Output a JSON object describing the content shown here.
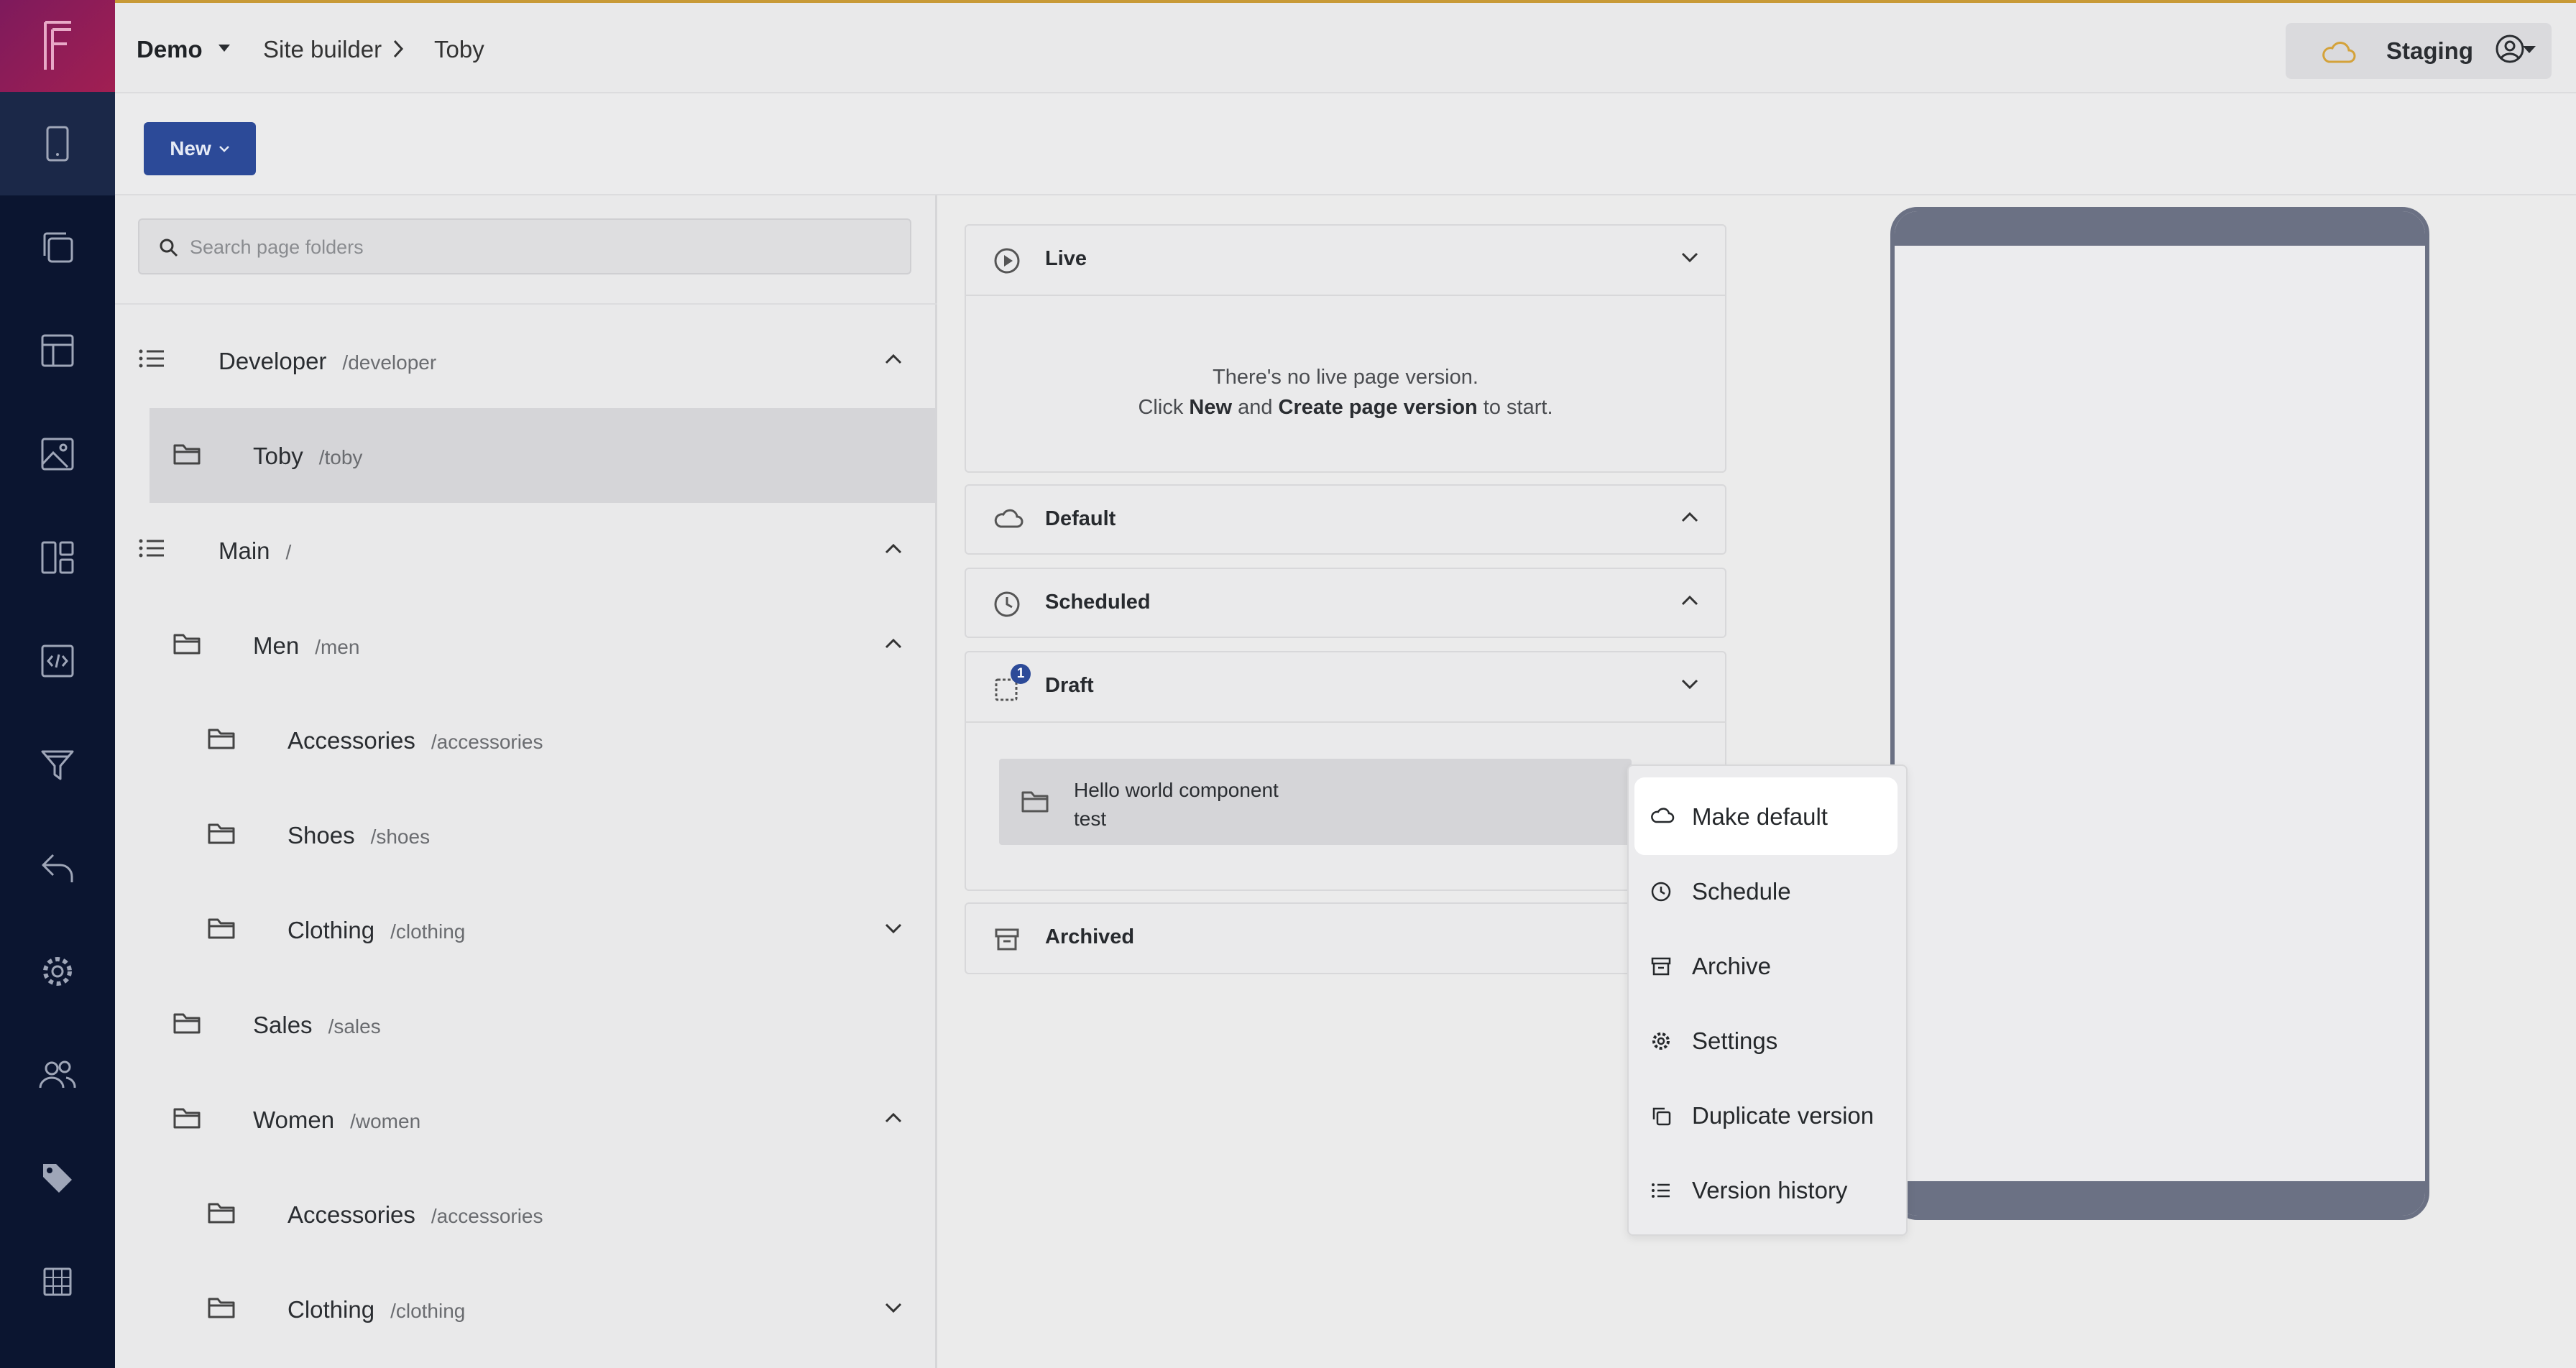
{
  "header": {
    "project": "Demo",
    "breadcrumb": [
      "Site builder",
      "Toby"
    ],
    "environment": "Staging"
  },
  "toolbar": {
    "new_label": "New"
  },
  "sidebar": {
    "items": [
      "logo-icon",
      "device-icon",
      "pages-icon",
      "layout-icon",
      "media-icon",
      "components-icon",
      "code-icon",
      "filter-icon",
      "undo-icon",
      "gear-icon",
      "users-icon",
      "tag-icon",
      "grid-icon"
    ]
  },
  "folders": {
    "search_placeholder": "Search page folders",
    "rows": [
      {
        "name": "Developer",
        "path": "/developer",
        "type": "list",
        "indent": 0,
        "chevron": "up"
      },
      {
        "name": "Toby",
        "path": "/toby",
        "type": "folder",
        "indent": 1,
        "chevron": "",
        "selected": true
      },
      {
        "name": "Main",
        "path": "/",
        "type": "list",
        "indent": 0,
        "chevron": "up"
      },
      {
        "name": "Men",
        "path": "/men",
        "type": "folder",
        "indent": 1,
        "chevron": "up"
      },
      {
        "name": "Accessories",
        "path": "/accessories",
        "type": "folder",
        "indent": 2,
        "chevron": ""
      },
      {
        "name": "Shoes",
        "path": "/shoes",
        "type": "folder",
        "indent": 2,
        "chevron": ""
      },
      {
        "name": "Clothing",
        "path": "/clothing",
        "type": "folder",
        "indent": 2,
        "chevron": "down"
      },
      {
        "name": "Sales",
        "path": "/sales",
        "type": "folder",
        "indent": 1,
        "chevron": ""
      },
      {
        "name": "Women",
        "path": "/women",
        "type": "folder",
        "indent": 1,
        "chevron": "up"
      },
      {
        "name": "Accessories",
        "path": "/accessories",
        "type": "folder",
        "indent": 2,
        "chevron": ""
      },
      {
        "name": "Clothing",
        "path": "/clothing",
        "type": "folder",
        "indent": 2,
        "chevron": "down"
      }
    ]
  },
  "versions": {
    "live": {
      "title": "Live",
      "message_line1": "There's no live page version.",
      "message_pre": "Click ",
      "message_new": "New",
      "message_and": " and ",
      "message_create": "Create page version",
      "message_post": " to start."
    },
    "default": {
      "title": "Default"
    },
    "scheduled": {
      "title": "Scheduled"
    },
    "draft": {
      "title": "Draft",
      "count": "1",
      "item_name": "Hello world component",
      "item_sub": "test"
    },
    "archived": {
      "title": "Archived"
    }
  },
  "menu": {
    "items": [
      {
        "label": "Make default",
        "icon": "cloud-icon"
      },
      {
        "label": "Schedule",
        "icon": "clock-icon"
      },
      {
        "label": "Archive",
        "icon": "archive-icon"
      },
      {
        "label": "Settings",
        "icon": "gear-icon"
      },
      {
        "label": "Duplicate version",
        "icon": "duplicate-icon"
      },
      {
        "label": "Version history",
        "icon": "list-icon"
      }
    ]
  },
  "colors": {
    "rail": "#0b1530",
    "accent": "#2c4a98",
    "logo": "#a11f52",
    "staging_cloud": "#d4a23a"
  }
}
